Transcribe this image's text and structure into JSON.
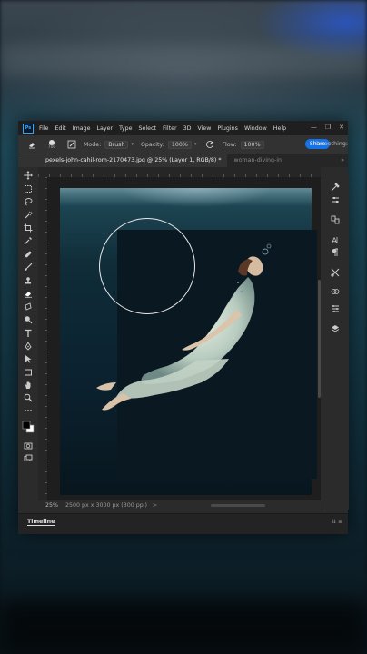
{
  "app": {
    "logo": "Ps",
    "menu": [
      "File",
      "Edit",
      "Image",
      "Layer",
      "Type",
      "Select",
      "Filter",
      "3D",
      "View",
      "Plugins",
      "Window",
      "Help"
    ],
    "window_controls": [
      "—",
      "❐",
      "✕"
    ]
  },
  "options_bar": {
    "brush_size": "700",
    "mode_label": "Mode:",
    "mode_value": "Brush",
    "opacity_label": "Opacity:",
    "opacity_value": "100%",
    "flow_label": "Flow:",
    "flow_value": "100%",
    "share_label": "Share",
    "smoothing_label": "Smoothing:"
  },
  "tabs": [
    {
      "label": "pexels-john-cahil-rom-2170473.jpg @ 25% (Layer 1, RGB/8) *",
      "active": true
    },
    {
      "label": "woman-diving-in",
      "active": false
    }
  ],
  "tabs_more": "»",
  "status": {
    "zoom": "25%",
    "dimensions": "2500 px x 3000 px (300 ppi)",
    "arrow": ">"
  },
  "timeline": {
    "label": "Timeline",
    "controls": "⇅ ≡"
  },
  "colors": {
    "accent": "#1473e6",
    "panel": "#2b2b2b",
    "menubar": "#1f1f1f"
  },
  "icons": {
    "tools": [
      "move-icon",
      "marquee-icon",
      "lasso-icon",
      "quick-select-icon",
      "crop-icon",
      "eyedropper-icon",
      "healing-icon",
      "brush-icon",
      "clone-stamp-icon",
      "eraser-icon",
      "gradient-icon",
      "dodge-icon",
      "pen-icon",
      "type-icon",
      "path-select-icon",
      "rectangle-icon",
      "hand-icon",
      "zoom-icon",
      "more-tools-icon",
      "color-swatches-icon",
      "quick-mask-icon",
      "screen-mode-icon"
    ],
    "panels": [
      "adjustments-icon",
      "properties-icon",
      "libraries-icon",
      "character-icon",
      "paragraph-icon",
      "tools-settings-icon",
      "channels-icon",
      "layers-panel-icon",
      "layers-icon"
    ]
  }
}
